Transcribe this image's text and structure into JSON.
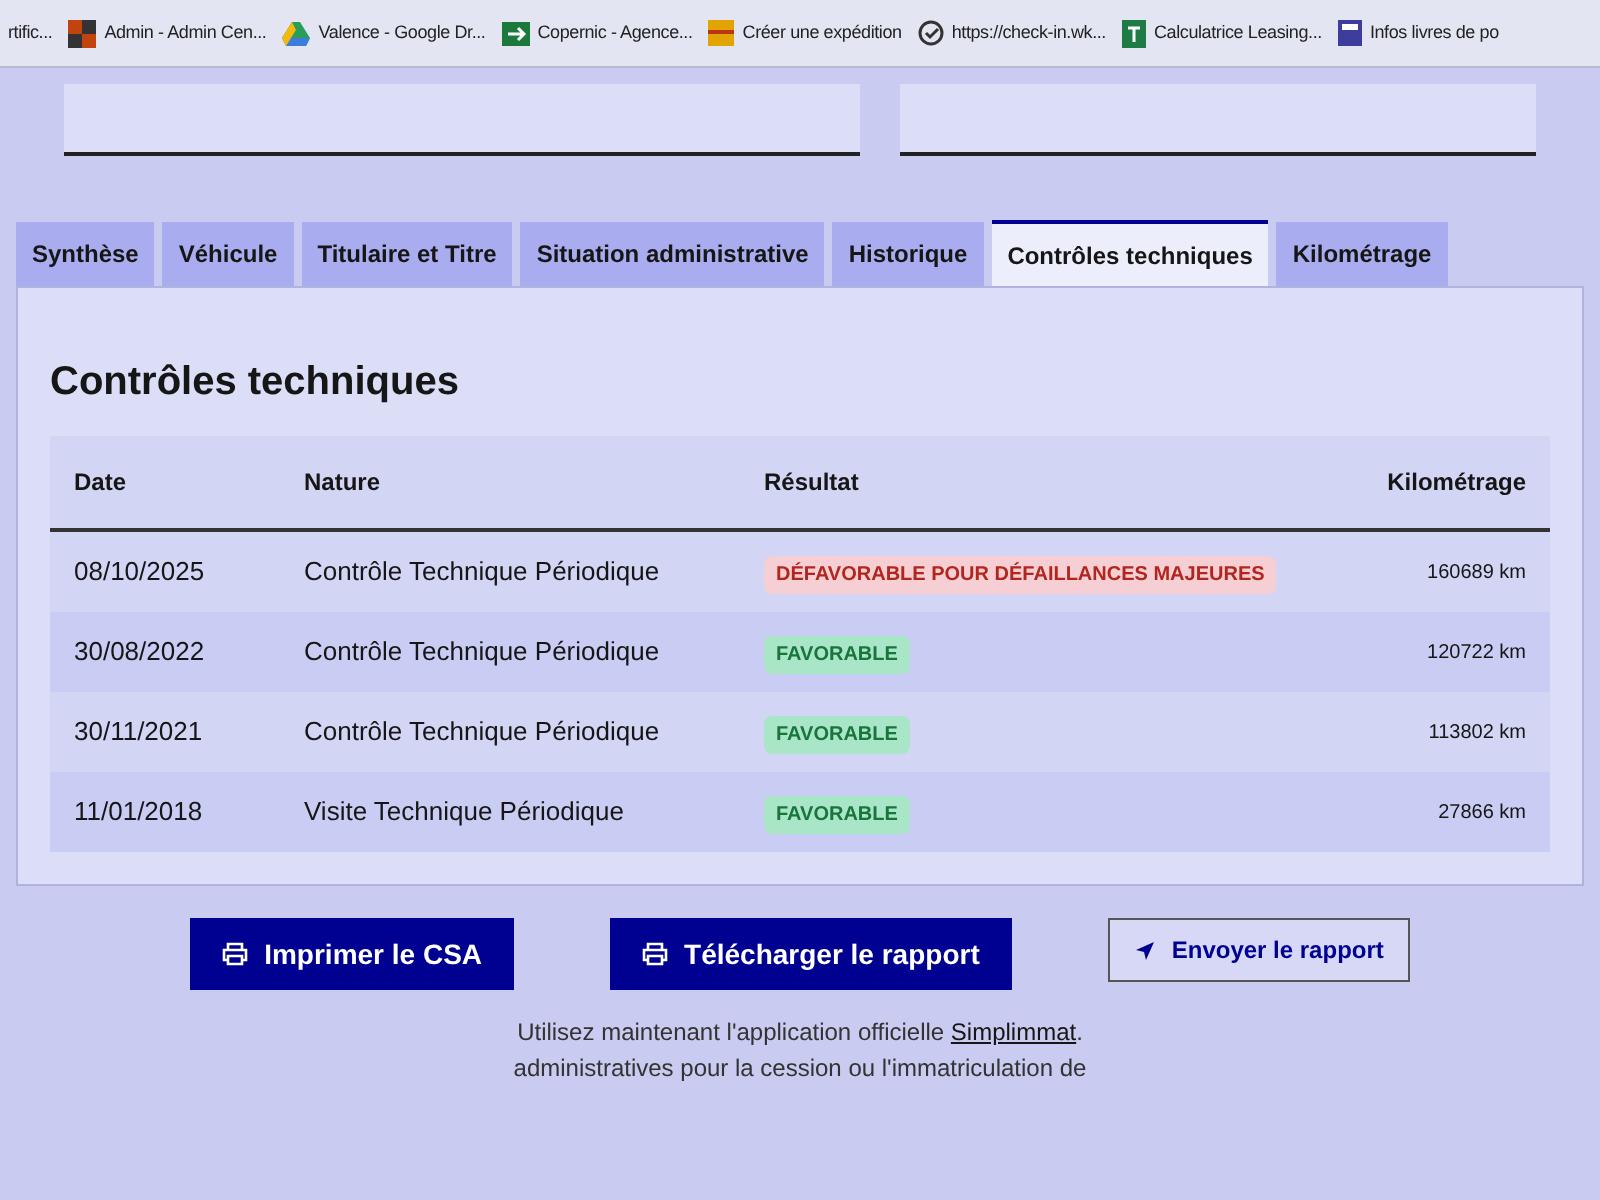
{
  "bookmarks": [
    {
      "label": "rtific...",
      "kind": "none"
    },
    {
      "label": "Admin - Admin Cen...",
      "kind": "squares"
    },
    {
      "label": "Valence - Google Dr...",
      "kind": "drive"
    },
    {
      "label": "Copernic - Agence...",
      "kind": "arrow"
    },
    {
      "label": "Créer une expédition",
      "kind": "parcel"
    },
    {
      "label": "https://check-in.wk...",
      "kind": "check"
    },
    {
      "label": "Calculatrice Leasing...",
      "kind": "sheet"
    },
    {
      "label": "Infos livres de po",
      "kind": "book"
    }
  ],
  "tabs": [
    {
      "label": "Synthèse",
      "selected": false
    },
    {
      "label": "Véhicule",
      "selected": false
    },
    {
      "label": "Titulaire et Titre",
      "selected": false
    },
    {
      "label": "Situation administrative",
      "selected": false
    },
    {
      "label": "Historique",
      "selected": false
    },
    {
      "label": "Contrôles techniques",
      "selected": true
    },
    {
      "label": "Kilométrage",
      "selected": false
    }
  ],
  "section": {
    "title": "Contrôles techniques"
  },
  "table": {
    "columns": [
      "Date",
      "Nature",
      "Résultat",
      "Kilométrage"
    ],
    "rows": [
      {
        "date": "08/10/2025",
        "nature": "Contrôle Technique Périodique",
        "result": {
          "label": "DÉFAVORABLE POUR DÉFAILLANCES MAJEURES",
          "kind": "error"
        },
        "km": "160689 km"
      },
      {
        "date": "30/08/2022",
        "nature": "Contrôle Technique Périodique",
        "result": {
          "label": "FAVORABLE",
          "kind": "success"
        },
        "km": "120722 km"
      },
      {
        "date": "30/11/2021",
        "nature": "Contrôle Technique Périodique",
        "result": {
          "label": "FAVORABLE",
          "kind": "success"
        },
        "km": "113802 km"
      },
      {
        "date": "11/01/2018",
        "nature": "Visite Technique Périodique",
        "result": {
          "label": "FAVORABLE",
          "kind": "success"
        },
        "km": "27866 km"
      }
    ]
  },
  "buttons": [
    {
      "label": "Imprimer le CSA",
      "kind": "primary"
    },
    {
      "label": "Télécharger le rapport",
      "kind": "primary"
    },
    {
      "label": "Envoyer le rapport",
      "kind": "secondary"
    }
  ],
  "notice": {
    "before": "Utilisez maintenant l'application officielle",
    "link": "Simplimmat",
    "after": ".",
    "line_2": "administratives pour la cession ou l'immatriculation de"
  }
}
